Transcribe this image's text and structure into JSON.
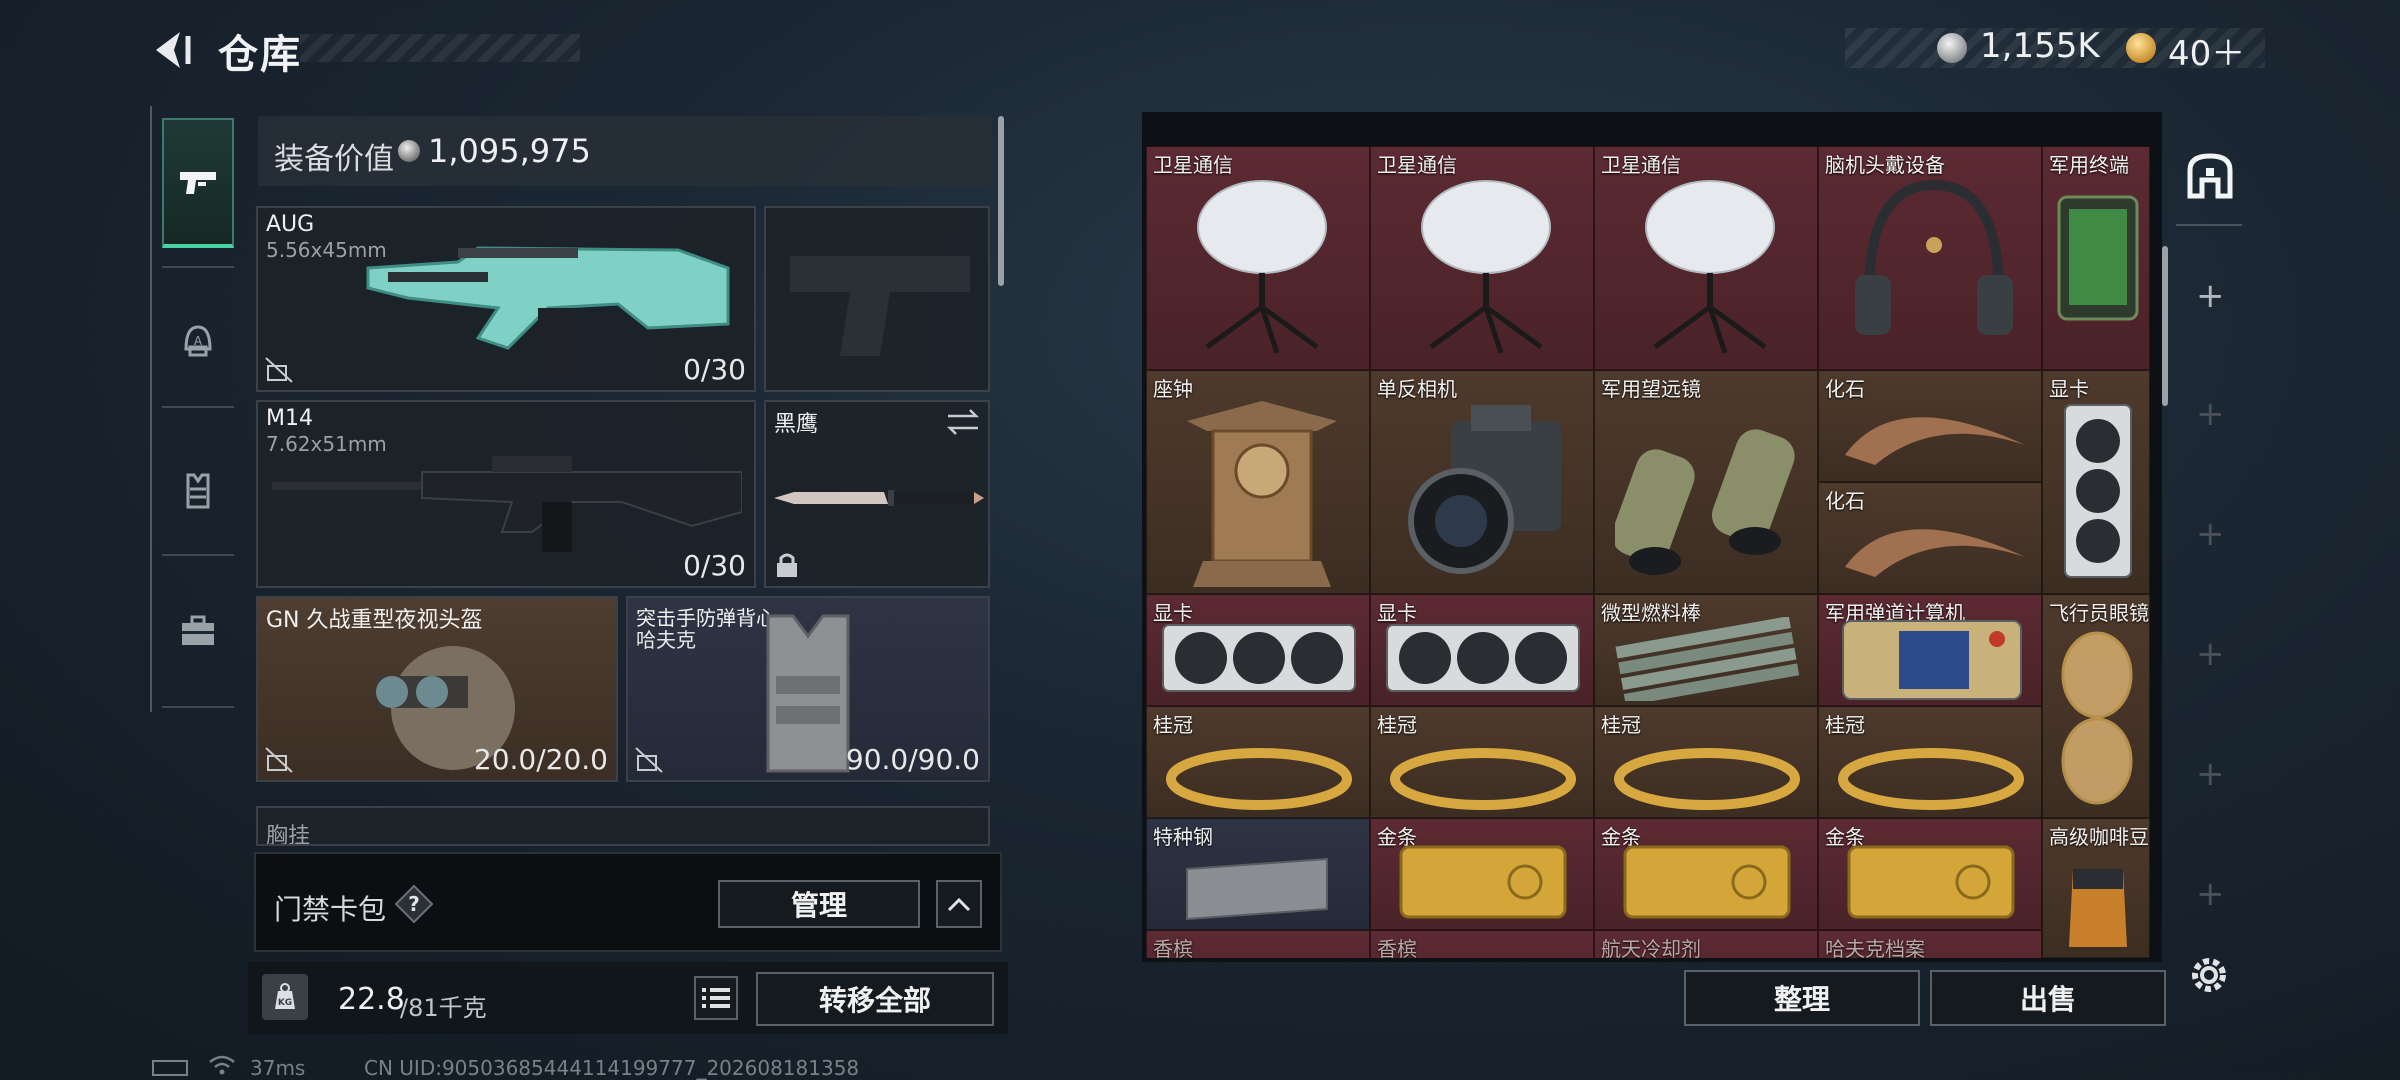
{
  "header": {
    "title": "仓库",
    "currency": [
      {
        "icon": "silver-coin-icon",
        "value": "1,155K"
      },
      {
        "icon": "gold-coin-icon",
        "value": "40＋"
      }
    ]
  },
  "nav": {
    "items": [
      {
        "icon": "pistol-icon",
        "active": true
      },
      {
        "icon": "helmet-icon",
        "active": false
      },
      {
        "icon": "vest-icon",
        "active": false
      },
      {
        "icon": "briefcase-icon",
        "active": false
      }
    ]
  },
  "equipment": {
    "value_label": "装备价值",
    "value": "1,095,975",
    "slots": {
      "primary1": {
        "name": "AUG",
        "sub": "5.56x45mm",
        "count": "0/30"
      },
      "pistol": {
        "name": ""
      },
      "primary2": {
        "name": "M14",
        "sub": "7.62x51mm",
        "count": "0/30"
      },
      "melee": {
        "name": "黑鹰"
      },
      "helmet": {
        "name": "GN 久战重型夜视头盔",
        "count": "20.0/20.0"
      },
      "armor": {
        "name": "突击手防弹背心",
        "sub": "哈夫克",
        "count": "90.0/90.0"
      }
    },
    "chest_partial": "胸挂"
  },
  "cardbag": {
    "label": "门禁卡包",
    "manage": "管理"
  },
  "bottom": {
    "weight": "22.8",
    "weight_max": "/81千克",
    "transfer_all": "转移全部"
  },
  "status": {
    "ping": "37ms",
    "uid": "CN UID:905036854441141997​77_202608181358"
  },
  "stash": {
    "rows": [
      [
        "卫星通信",
        "卫星通信",
        "卫星通信",
        "脑机头戴设备",
        "军用终端"
      ],
      [
        "座钟",
        "单反相机",
        "军用望远镜",
        "化石",
        "显卡"
      ],
      [
        "",
        "",
        "",
        "化石",
        ""
      ],
      [
        "显卡",
        "显卡",
        "微型燃料棒",
        "军用弹道计算机",
        "飞行员眼镜"
      ],
      [
        "桂冠",
        "桂冠",
        "桂冠",
        "桂冠",
        ""
      ],
      [
        "特种钢",
        "金条",
        "金条",
        "金条",
        "高级咖啡豆"
      ],
      [
        "香槟",
        "香槟",
        "航天冷却剂",
        "哈夫克档案",
        ""
      ]
    ],
    "sort": "整理",
    "sell": "出售"
  },
  "colors": {
    "accent": "#48d1a3",
    "red_rarity": "#5c2a32",
    "gold_rarity": "#4e3a2c",
    "blue_rarity": "#2e3444"
  }
}
